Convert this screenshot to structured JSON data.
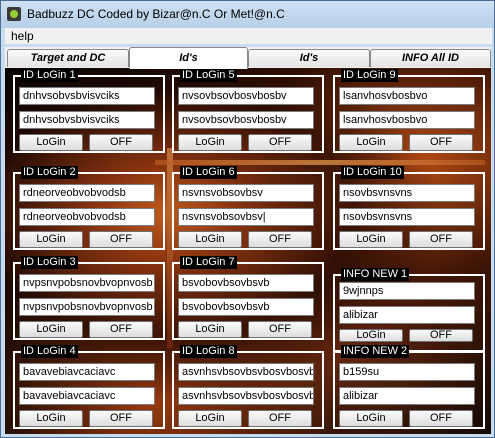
{
  "window": {
    "title": "Badbuzz DC Coded by Bizar@n.C Or Met!@n.C"
  },
  "menu": {
    "help": "help"
  },
  "tabs": [
    "Target and DC",
    "Id's",
    "Id's",
    "INFO All ID"
  ],
  "buttons": {
    "login": "LoGin",
    "off": "OFF"
  },
  "groups": [
    {
      "title": "ID LoGin 1",
      "f1": "dnhvsobvsbvisvciks",
      "f2": "dnhvsobvsbvisvciks"
    },
    {
      "title": "ID LoGin 5",
      "f1": "nvsovbsovbosvbosbv",
      "f2": "nvsovbsovbosvbosbv"
    },
    {
      "title": "ID LoGin 9",
      "f1": "lsanvhosvbosbvo",
      "f2": "lsanvhosvbosbvo"
    },
    {
      "title": "ID LoGin 2",
      "f1": "rdneorveobvobvodsb",
      "f2": "rdneorveobvobvodsb"
    },
    {
      "title": "ID LoGin 6",
      "f1": "nsvnsvobsovbsv",
      "f2": "nsvnsvobsovbsv|"
    },
    {
      "title": "ID LoGin 10",
      "f1": "nsovbsvnsvns",
      "f2": "nsovbsvnsvns"
    },
    {
      "title": "ID LoGin 3",
      "f1": "nvpsnvpobsnovbvopnvosb",
      "f2": "nvpsnvpobsnovbvopnvosb"
    },
    {
      "title": "ID LoGin 7",
      "f1": "bsvobovbsovbsvb",
      "f2": "bsvobovbsovbsvb"
    },
    {
      "title": "INFO NEW 1",
      "f1": "9wjnnps",
      "f2": "alibizar"
    },
    {
      "title": "ID LoGin 4",
      "f1": "bavavebiavcaciavc",
      "f2": "bavavebiavcaciavc"
    },
    {
      "title": "ID LoGin 8",
      "f1": "asvnhsvbsovbsvbosvbosvbv",
      "f2": "asvnhsvbsovbsvbosvbosvbv"
    },
    {
      "title": "INFO NEW 2",
      "f1": "b159su",
      "f2": "alibizar"
    }
  ]
}
